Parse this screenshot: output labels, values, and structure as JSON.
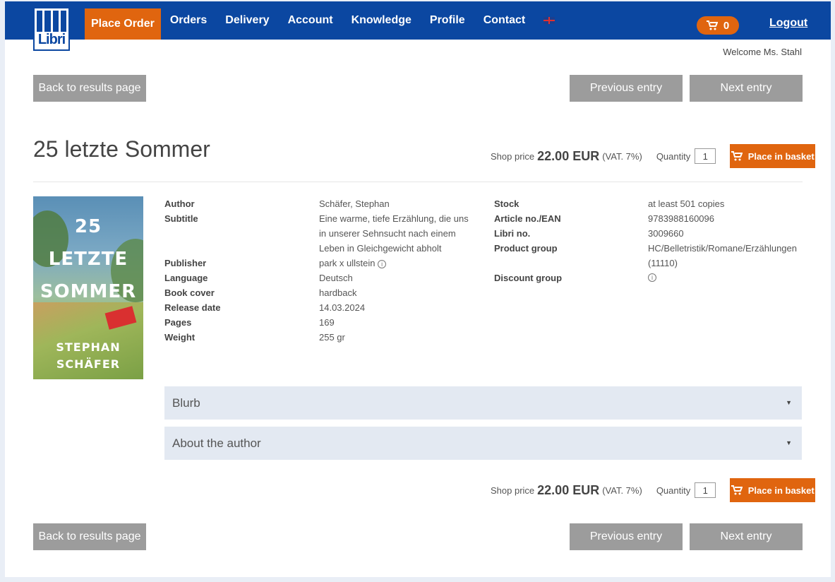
{
  "header": {
    "logo_text": "Libri",
    "nav": [
      "Place Order",
      "Orders",
      "Delivery",
      "Account",
      "Knowledge",
      "Profile",
      "Contact"
    ],
    "cart_count": "0",
    "logout_label": "Logout",
    "welcome": "Welcome Ms. Stahl"
  },
  "navigation": {
    "back_label": "Back to results page",
    "previous_label": "Previous entry",
    "next_label": "Next entry"
  },
  "product": {
    "title": "25 letzte Sommer",
    "price_label": "Shop price",
    "price": "22.00 EUR",
    "vat": "(VAT. 7%)",
    "quantity_label": "Quantity",
    "quantity": "1",
    "basket_label": "Place in basket"
  },
  "cover": {
    "line1": "25",
    "line2": "LETZTE",
    "line3": "SOMMER",
    "author1": "STEPHAN",
    "author2": "SCHÄFER"
  },
  "details_left": [
    {
      "label": "Author",
      "value": "Schäfer, Stephan"
    },
    {
      "label": "Subtitle",
      "value": "Eine warme, tiefe Erzählung, die uns in unserer Sehnsucht nach einem Leben in Gleichgewicht abholt"
    },
    {
      "label": "Publisher",
      "value": "park x ullstein"
    },
    {
      "label": "Language",
      "value": "Deutsch"
    },
    {
      "label": "Book cover",
      "value": "hardback"
    },
    {
      "label": "Release date",
      "value": "14.03.2024"
    },
    {
      "label": "Pages",
      "value": "169"
    },
    {
      "label": "Weight",
      "value": "255 gr"
    }
  ],
  "details_right": [
    {
      "label": "Stock",
      "value": "at least 501 copies"
    },
    {
      "label": "Article no./EAN",
      "value": "9783988160096"
    },
    {
      "label": "Libri no.",
      "value": "3009660"
    },
    {
      "label": "Product group",
      "value": "HC/Belletristik/Romane/Erzählungen (11110)"
    },
    {
      "label": "Discount group",
      "value": ""
    }
  ],
  "accordions": [
    "Blurb",
    "About the author"
  ],
  "colors": {
    "brand_blue": "#0b47a1",
    "accent_orange": "#e0650f",
    "button_grey": "#9c9c9c"
  }
}
